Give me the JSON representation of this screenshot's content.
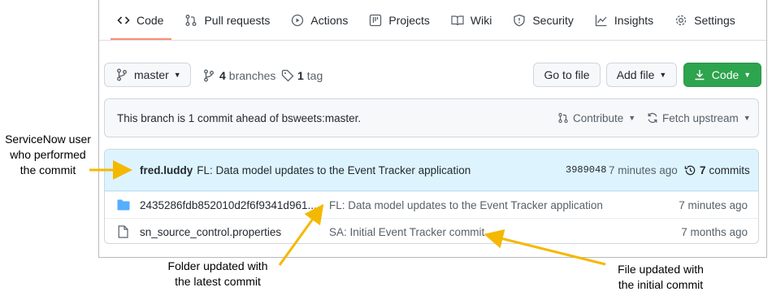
{
  "tabs": [
    {
      "label": "Code",
      "icon": "code-icon"
    },
    {
      "label": "Pull requests",
      "icon": "pull-request-icon"
    },
    {
      "label": "Actions",
      "icon": "play-icon"
    },
    {
      "label": "Projects",
      "icon": "table-icon"
    },
    {
      "label": "Wiki",
      "icon": "book-icon"
    },
    {
      "label": "Security",
      "icon": "shield-icon"
    },
    {
      "label": "Insights",
      "icon": "graph-icon"
    },
    {
      "label": "Settings",
      "icon": "gear-icon"
    }
  ],
  "branch_bar": {
    "branch": "master",
    "branches_count": "4",
    "branches_label": "branches",
    "tags_count": "1",
    "tags_label": "tag",
    "go_to_file": "Go to file",
    "add_file": "Add file",
    "code": "Code"
  },
  "ahead_banner": {
    "text": "This branch is 1 commit ahead of bsweets:master.",
    "contribute": "Contribute",
    "fetch_upstream": "Fetch upstream"
  },
  "latest_commit": {
    "author": "fred.luddy",
    "message": "FL: Data model updates to the Event Tracker application",
    "sha": "3989048",
    "time": "7 minutes ago",
    "commits_count": "7",
    "commits_label": "commits"
  },
  "files": [
    {
      "type": "folder",
      "icon": "folder-icon",
      "name": "2435286fdb852010d2f6f9341d961...",
      "message": "FL: Data model updates to the Event Tracker application",
      "time": "7 minutes ago"
    },
    {
      "type": "file",
      "icon": "file-icon",
      "name": "sn_source_control.properties",
      "message": "SA: Initial Event Tracker commit",
      "time": "7 months ago"
    }
  ],
  "annotations": {
    "user": [
      "ServiceNow user",
      "who performed",
      "the commit"
    ],
    "folder": [
      "Folder updated with",
      "the latest commit"
    ],
    "file": [
      "File updated with",
      "the initial commit"
    ]
  },
  "colors": {
    "accent_green": "#2da44e",
    "arrow": "#f5b800",
    "tab_underline": "#fd8c73",
    "folder": "#54aeff"
  }
}
